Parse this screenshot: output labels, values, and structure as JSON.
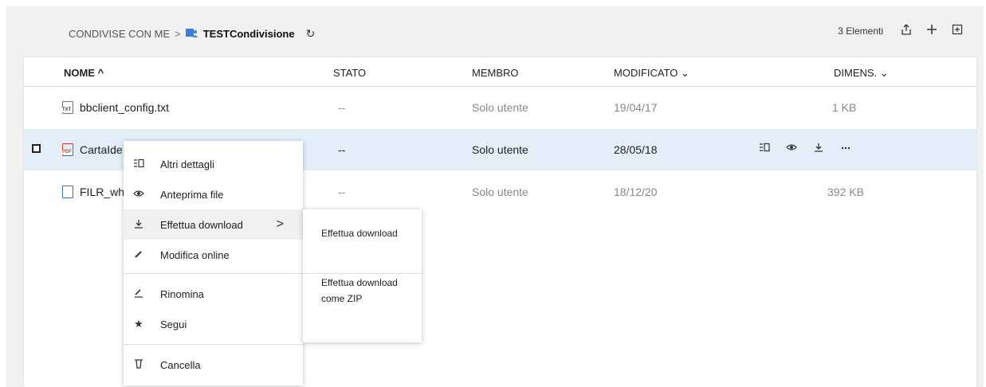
{
  "breadcrumb": {
    "root": "CONDIVISE CON ME",
    "separator": ">",
    "folder": "TESTCondivisione",
    "folder_icon": "shared-folder-icon",
    "refresh_icon": "refresh-icon"
  },
  "toolbar": {
    "count": "3 Elementi",
    "share_icon": "share-icon",
    "add_icon": "plus-icon",
    "new_folder_icon": "new-folder-icon"
  },
  "table": {
    "headers": {
      "name": "NOME ^",
      "status": "STATO",
      "member": "MEMBRO",
      "modified": "MODIFICATO ⌄",
      "size": "DIMENS. ⌄"
    },
    "rows": [
      {
        "name": "bbclient_config.txt",
        "icon": "TXT",
        "status": "--",
        "member": "Solo utente",
        "modified": "19/04/17",
        "size": "1 KB"
      },
      {
        "name": "CartaIde",
        "icon": "PDF",
        "status": "--",
        "member": "Solo utente",
        "modified": "28/05/18",
        "size": ""
      },
      {
        "name": "FILR_wh",
        "icon": "DOC",
        "status": "--",
        "member": "Solo utente",
        "modified": "18/12/20",
        "size": "392 KB"
      }
    ]
  },
  "context_menu": {
    "items": [
      {
        "label": "Altri dettagli",
        "icon": "details-icon"
      },
      {
        "label": "Anteprima file",
        "icon": "eye-icon"
      },
      {
        "label": "Effettua download",
        "icon": "download-icon",
        "chevron": ">"
      },
      {
        "label": "Modifica online",
        "icon": "pencil-icon"
      },
      {
        "label": "Rinomina",
        "icon": "rename-icon"
      },
      {
        "label": "Segui",
        "icon": "star-icon"
      },
      {
        "label": "Cancella",
        "icon": "trash-icon"
      }
    ]
  },
  "submenu": {
    "items": [
      {
        "label": "Effettua download"
      },
      {
        "label": "Effettua download come ZIP"
      }
    ]
  },
  "colors": {
    "selected_row": "#e3eef9",
    "panel_bg": "#f1f1f1",
    "folder_blue": "#3b7dd8",
    "pdf_red": "#c43333"
  }
}
